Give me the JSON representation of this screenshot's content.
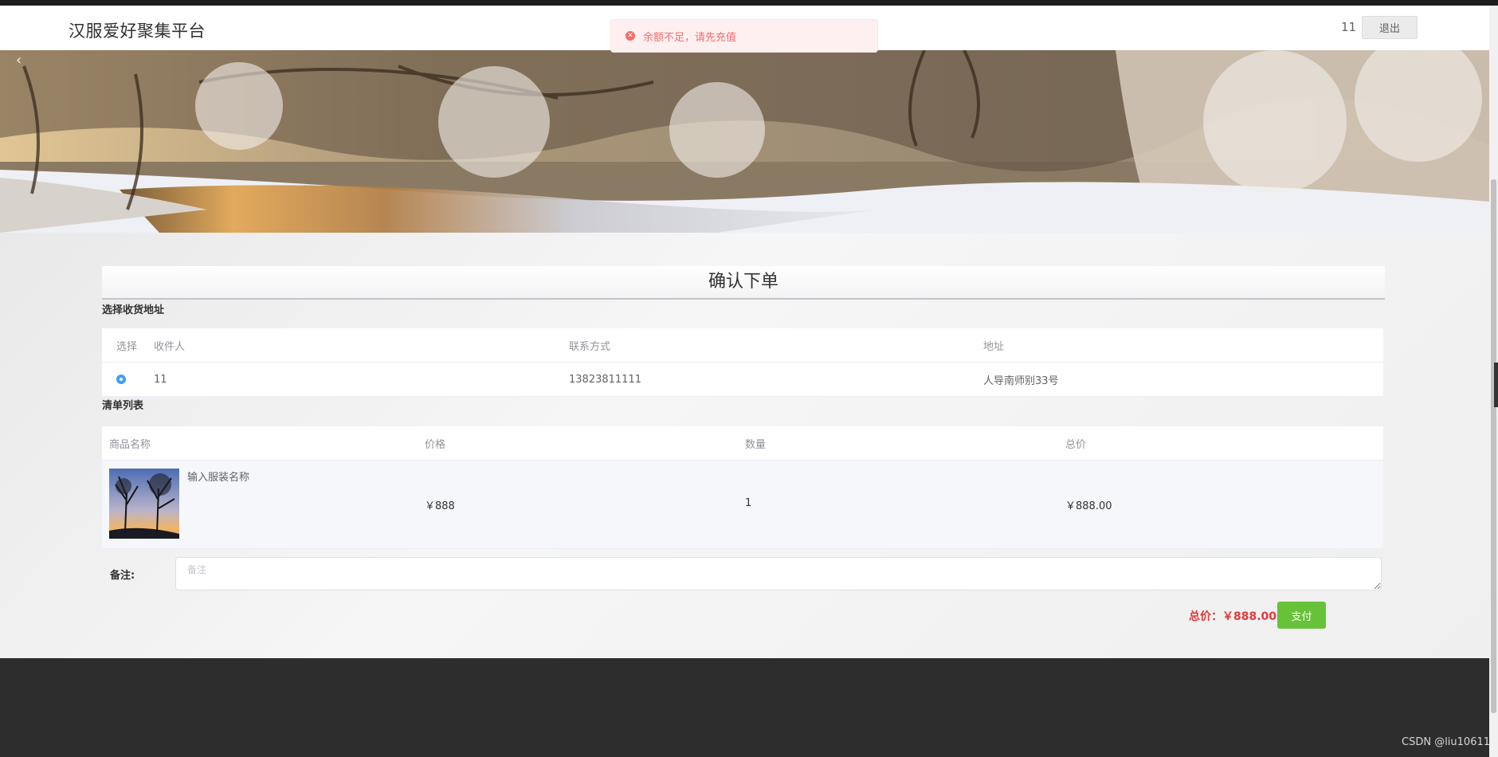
{
  "header": {
    "site_title": "汉服爱好聚集平台",
    "username": "11",
    "logout_label": "退出"
  },
  "toast": {
    "icon": "error-circle-icon",
    "message": "余额不足，请先充值"
  },
  "card": {
    "title": "确认下单"
  },
  "address_section": {
    "title": "选择收货地址",
    "columns": [
      "选择",
      "收件人",
      "联系方式",
      "地址"
    ],
    "rows": [
      {
        "selected": true,
        "recipient": "11",
        "phone": "13823811111",
        "address": "人导南师别33号"
      }
    ]
  },
  "goods_section": {
    "title": "清单列表",
    "columns": [
      "商品名称",
      "价格",
      "数量",
      "总价"
    ],
    "rows": [
      {
        "name": "输入服装名称",
        "price": "￥888",
        "quantity": "1",
        "subtotal": "￥888.00"
      }
    ]
  },
  "remark": {
    "label": "备注:",
    "placeholder": "备注"
  },
  "summary": {
    "total_text": "总价：￥888.00",
    "pay_label": "支付"
  },
  "watermark": "CSDN @liu10611",
  "colors": {
    "pay_button": "#67c23a",
    "total_text": "#e4393c",
    "toast_text": "#f56c6c",
    "radio_selected": "#409eff",
    "footer": "#2d2d2d"
  }
}
